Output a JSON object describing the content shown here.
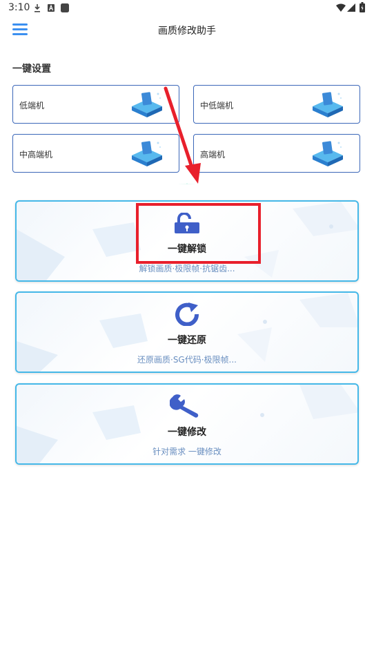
{
  "status_bar": {
    "time": "3:10",
    "icons": [
      "download-icon",
      "a-badge-icon",
      "app-square-icon",
      "wifi-icon",
      "signal-icon",
      "battery-icon"
    ]
  },
  "app_bar": {
    "title": "画质修改助手",
    "menu_icon": "hamburger-menu-icon"
  },
  "section": {
    "title": "一键设置"
  },
  "presets": [
    {
      "label": "低端机"
    },
    {
      "label": "中低端机"
    },
    {
      "label": "中高端机"
    },
    {
      "label": "高端机"
    }
  ],
  "cards": [
    {
      "title": "一键解锁",
      "subtitle": "解锁画质·极限帧·抗锯齿...",
      "icon": "unlock-icon"
    },
    {
      "title": "一键还原",
      "subtitle": "还原画质·SG代码·极限帧...",
      "icon": "refresh-icon"
    },
    {
      "title": "一键修改",
      "subtitle": "针对需求 一键修改",
      "icon": "wrench-icon"
    }
  ],
  "colors": {
    "accent_blue": "#3b8ff0",
    "icon_blue": "#3f5fc8",
    "card_border": "#45b8e8",
    "annotation_red": "#e8202c"
  }
}
